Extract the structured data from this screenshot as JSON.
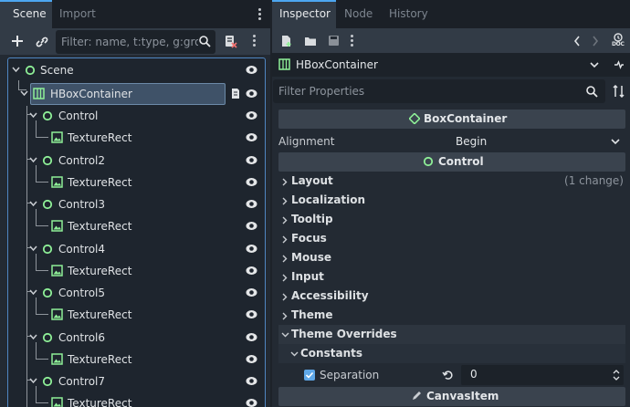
{
  "scene_dock": {
    "tabs": [
      {
        "label": "Scene",
        "active": true
      },
      {
        "label": "Import",
        "active": false
      }
    ],
    "filter_placeholder": "Filter: name, t:type, g:grou",
    "tree": [
      {
        "label": "Scene",
        "type": "root",
        "expanded": true
      },
      {
        "label": "HBoxContainer",
        "type": "hbox",
        "selected": true,
        "expanded": true
      },
      {
        "label": "Control",
        "type": "control"
      },
      {
        "label": "TextureRect",
        "type": "texture"
      },
      {
        "label": "Control2",
        "type": "control"
      },
      {
        "label": "TextureRect",
        "type": "texture"
      },
      {
        "label": "Control3",
        "type": "control"
      },
      {
        "label": "TextureRect",
        "type": "texture"
      },
      {
        "label": "Control4",
        "type": "control"
      },
      {
        "label": "TextureRect",
        "type": "texture"
      },
      {
        "label": "Control5",
        "type": "control"
      },
      {
        "label": "TextureRect",
        "type": "texture"
      },
      {
        "label": "Control6",
        "type": "control"
      },
      {
        "label": "TextureRect",
        "type": "texture"
      },
      {
        "label": "Control7",
        "type": "control"
      },
      {
        "label": "TextureRect",
        "type": "texture"
      }
    ]
  },
  "inspector": {
    "tabs": [
      {
        "label": "Inspector",
        "active": true
      },
      {
        "label": "Node",
        "active": false
      },
      {
        "label": "History",
        "active": false
      }
    ],
    "doc_label": "DOC",
    "node_path": "HBoxContainer",
    "filter_placeholder": "Filter Properties",
    "box_container_header": "BoxContainer",
    "alignment": {
      "label": "Alignment",
      "value": "Begin"
    },
    "control_header": "Control",
    "categories": [
      {
        "label": "Layout",
        "note": "(1 change)"
      },
      {
        "label": "Localization",
        "note": ""
      },
      {
        "label": "Tooltip",
        "note": ""
      },
      {
        "label": "Focus",
        "note": ""
      },
      {
        "label": "Mouse",
        "note": ""
      },
      {
        "label": "Input",
        "note": ""
      },
      {
        "label": "Accessibility",
        "note": ""
      },
      {
        "label": "Theme",
        "note": ""
      }
    ],
    "theme_overrides": "Theme Overrides",
    "constants": "Constants",
    "separation": {
      "label": "Separation",
      "value": "0",
      "checked": true
    },
    "canvas_item_header": "CanvasItem"
  },
  "colors": {
    "accent_blue": "#4da6f0",
    "control_green": "#8eef97",
    "selection": "#3f5268"
  }
}
